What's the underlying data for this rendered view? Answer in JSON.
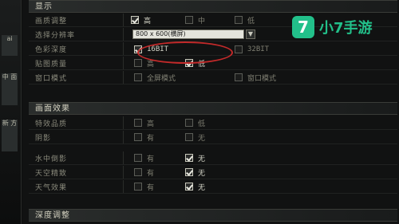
{
  "left_strip": [
    "ai",
    "中\n\n面",
    "",
    "新\n\n方"
  ],
  "sections": {
    "display": "显示",
    "effects": "画面效果",
    "depth": "深度调整"
  },
  "rows": {
    "texture_quality": {
      "label": "画质调整",
      "options": [
        {
          "text": "高",
          "checked": true
        },
        {
          "text": "中",
          "checked": false
        },
        {
          "text": "低",
          "checked": false
        }
      ]
    },
    "resolution": {
      "label": "选择分辨率",
      "value": "800 x 600(横屏)",
      "arrow": "▼"
    },
    "color_depth": {
      "label": "色彩深度",
      "options": [
        {
          "text": "16BIT",
          "checked": true
        },
        {
          "text": "32BIT",
          "checked": false
        }
      ]
    },
    "vsync": {
      "label": "贴图质量",
      "options": [
        {
          "text": "高",
          "checked": false
        },
        {
          "text": "低",
          "checked": true
        }
      ]
    },
    "window_mode": {
      "label": "窗口模式",
      "options": [
        {
          "text": "全屏模式",
          "checked": false
        },
        {
          "text": "窗口模式",
          "checked": false
        }
      ]
    },
    "effect_quality": {
      "label": "特效品质",
      "options": [
        {
          "text": "高",
          "checked": false
        },
        {
          "text": "低",
          "checked": false
        }
      ]
    },
    "shadow": {
      "label": "阴影",
      "options": [
        {
          "text": "有",
          "checked": false
        },
        {
          "text": "无",
          "checked": false
        }
      ]
    },
    "water_reflect": {
      "label": "水中倒影",
      "options": [
        {
          "text": "有",
          "checked": false
        },
        {
          "text": "无",
          "checked": true
        }
      ]
    },
    "terrain_detail": {
      "label": "天空精致",
      "options": [
        {
          "text": "有",
          "checked": false
        },
        {
          "text": "无",
          "checked": true
        }
      ]
    },
    "weather": {
      "label": "天气效果",
      "options": [
        {
          "text": "有",
          "checked": false
        },
        {
          "text": "无",
          "checked": true
        }
      ]
    }
  },
  "logo": {
    "mark": "7",
    "text": "小7手游"
  }
}
